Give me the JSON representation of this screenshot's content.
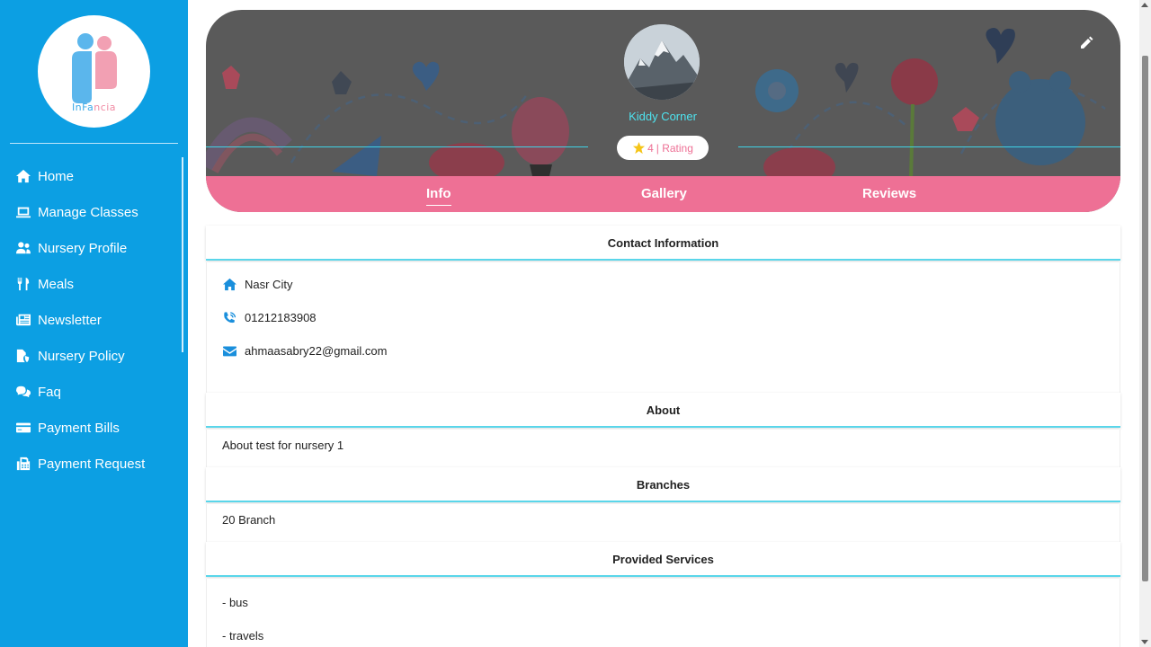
{
  "app": {
    "logo_text_a": "InFa",
    "logo_text_b": "ncia"
  },
  "sidebar": {
    "items": [
      {
        "label": "Home",
        "icon": "home-icon"
      },
      {
        "label": "Manage Classes",
        "icon": "laptop-icon"
      },
      {
        "label": "Nursery Profile",
        "icon": "users-icon"
      },
      {
        "label": "Meals",
        "icon": "utensils-icon"
      },
      {
        "label": "Newsletter",
        "icon": "newspaper-icon"
      },
      {
        "label": "Nursery Policy",
        "icon": "file-shield-icon"
      },
      {
        "label": "Faq",
        "icon": "comments-icon"
      },
      {
        "label": "Payment Bills",
        "icon": "credit-card-icon"
      },
      {
        "label": "Payment Request",
        "icon": "fax-icon"
      }
    ]
  },
  "profile": {
    "name": "Kiddy Corner",
    "rating_value": "4",
    "rating_label": "| Rating"
  },
  "tabs": [
    {
      "label": "Info",
      "active": true
    },
    {
      "label": "Gallery",
      "active": false
    },
    {
      "label": "Reviews",
      "active": false
    }
  ],
  "contact": {
    "title": "Contact Information",
    "address": "Nasr City",
    "phone": "01212183908",
    "email": "ahmaasabry22@gmail.com"
  },
  "about": {
    "title": "About",
    "text": "About test for nursery 1"
  },
  "branches": {
    "title": "Branches",
    "text": "20 Branch"
  },
  "services": {
    "title": "Provided Services",
    "items": [
      "- bus",
      "- travels"
    ]
  },
  "colors": {
    "sidebar": "#0c9fe3",
    "tab_bar": "#ee7095",
    "accent_cyan": "#4ee3ef",
    "banner_bg": "#5a5a5a"
  }
}
